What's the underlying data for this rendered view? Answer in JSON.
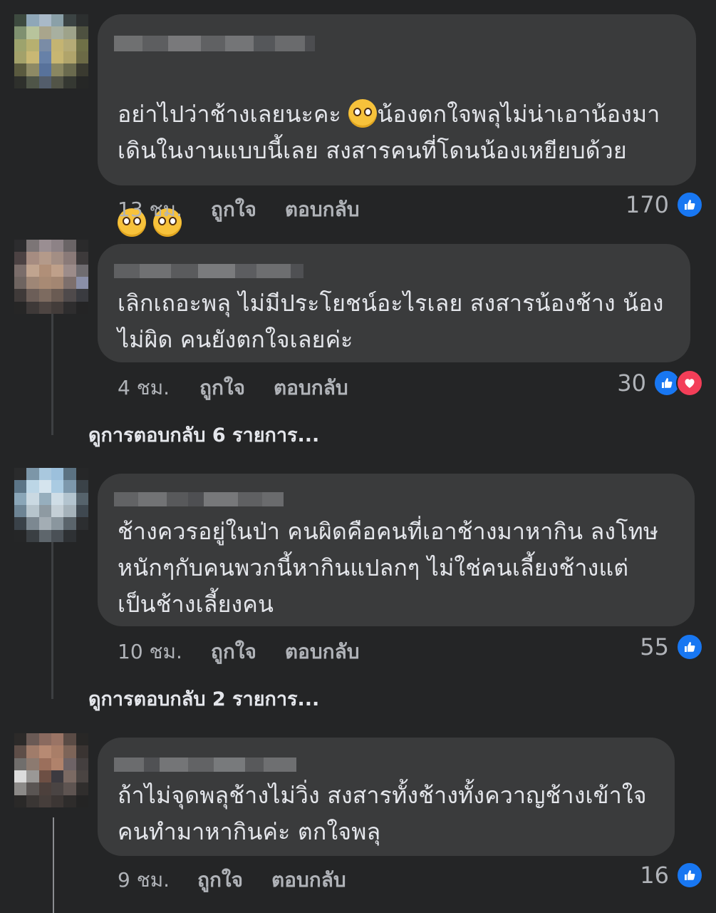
{
  "comments": [
    {
      "text_before_emoji": "อย่าไปว่าช้างเลยนะคะ ",
      "text_after_emoji": "น้องตกใจพลุไม่น่าเอาน้องมา\nเดินในงานแบบนี้เลย สงสารคนที่โดนน้องเหยียบด้วย",
      "time": "13 ชม.",
      "like_label": "ถูกใจ",
      "reply_label": "ตอบกลับ",
      "reaction_count": "170",
      "reactions": [
        "like"
      ]
    },
    {
      "text": "เลิกเถอะพลุ ไม่มีประโยชน์อะไรเลย สงสารน้องช้าง น้อง\nไม่ผิด คนยังตกใจเลยค่ะ",
      "time": "4 ชม.",
      "like_label": "ถูกใจ",
      "reply_label": "ตอบกลับ",
      "reaction_count": "30",
      "reactions": [
        "like",
        "love"
      ],
      "more_replies": "ดูการตอบกลับ 6 รายการ..."
    },
    {
      "text": "ช้างควรอยู่ในป่า คนผิดคือคนที่เอาช้างมาหากิน ลงโทษ\nหนักๆกับคนพวกนี้หากินแปลกๆ ไม่ใช่คนเลี้ยงช้างแต่\nเป็นช้างเลี้ยงคน",
      "time": "10 ชม.",
      "like_label": "ถูกใจ",
      "reply_label": "ตอบกลับ",
      "reaction_count": "55",
      "reactions": [
        "like"
      ],
      "more_replies": "ดูการตอบกลับ 2 รายการ..."
    },
    {
      "text": "ถ้าไม่จุดพลุช้างไม่วิ่ง สงสารทั้งช้างทั้งควาญช้างเข้าใจ\nคนทำมาหากินค่ะ ตกใจพลุ",
      "time": "9 ชม.",
      "like_label": "ถูกใจ",
      "reply_label": "ตอบกลับ",
      "reaction_count": "16",
      "reactions": [
        "like"
      ]
    }
  ],
  "icons": {
    "emoji": "pleading-face-emoji",
    "like": "thumbs-up-icon",
    "love": "heart-icon"
  },
  "colors": {
    "background": "#242526",
    "bubble": "#3a3b3c",
    "text": "#e4e6eb",
    "meta_text": "#b0b3b8",
    "like_blue": "#1877f2",
    "love_red": "#f33e58"
  }
}
